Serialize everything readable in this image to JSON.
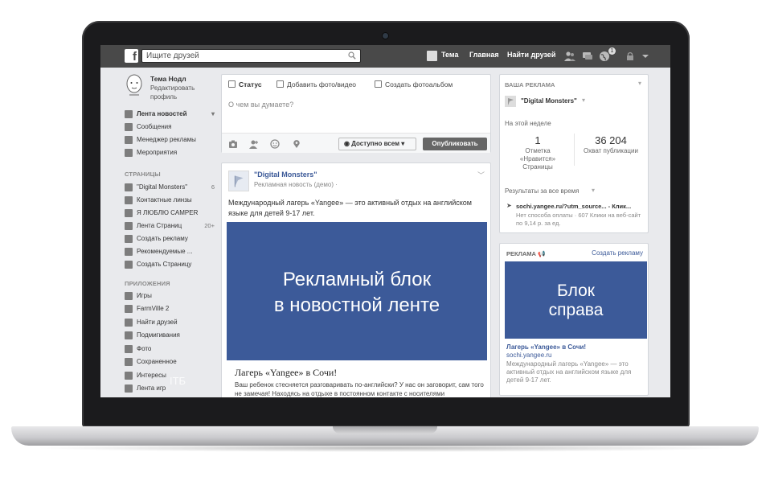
{
  "topbar": {
    "search_placeholder": "Ищите друзей",
    "nav_profile": "Тема",
    "nav_home": "Главная",
    "nav_find_friends": "Найти друзей",
    "notifications_count": "1"
  },
  "profile": {
    "name": "Тема Нодл",
    "edit_label": "Редактировать профиль"
  },
  "sidebar": {
    "favorites": [
      {
        "label": "Лента новостей",
        "icon": "news-feed-icon"
      },
      {
        "label": "Сообщения",
        "icon": "messages-icon"
      },
      {
        "label": "Менеджер рекламы",
        "icon": "ads-manager-icon"
      },
      {
        "label": "Мероприятия",
        "icon": "events-icon"
      }
    ],
    "pages_heading": "СТРАНИЦЫ",
    "pages": [
      {
        "label": "\"Digital Monsters\"",
        "count": "6"
      },
      {
        "label": "Контактные линзы",
        "count": ""
      },
      {
        "label": "Я ЛЮБЛЮ CAMPER",
        "count": ""
      },
      {
        "label": "Лента Страниц",
        "count": "20+"
      },
      {
        "label": "Создать рекламу",
        "count": ""
      },
      {
        "label": "Рекомендуемые ...",
        "count": ""
      },
      {
        "label": "Создать Страницу",
        "count": ""
      }
    ],
    "apps_heading": "ПРИЛОЖЕНИЯ",
    "apps": [
      {
        "label": "Игры"
      },
      {
        "label": "FarmVille 2"
      },
      {
        "label": "Найти друзей"
      },
      {
        "label": "Подмигивания"
      },
      {
        "label": "Фото"
      },
      {
        "label": "Сохраненное"
      },
      {
        "label": "Интересы"
      },
      {
        "label": "Лента игр"
      }
    ]
  },
  "composer": {
    "tab_status": "Статус",
    "tab_photo": "Добавить фото/видео",
    "tab_album": "Создать фотоальбом",
    "placeholder": "О чем вы думаете?",
    "audience": "Доступно всем",
    "publish": "Опубликовать"
  },
  "post": {
    "page_name": "\"Digital Monsters\"",
    "subtitle": "Рекламная новость (демо) ·",
    "text": "Международный лагерь «Yangee» — это активный отдых на английском языке для детей 9-17 лет.",
    "banner_line1": "Рекламный блок",
    "banner_line2": "в новостной ленте",
    "link_title": "Лагерь «Yangee» в Сочи!",
    "link_desc": "Ваш ребенок стесняется разговаривать по-английски? У нас он заговорит, сам того не замечая! Находясь на отдыхе в постоянном контакте с носителями"
  },
  "your_ads": {
    "heading": "ВАША РЕКЛАМА",
    "page_name": "\"Digital Monsters\"",
    "this_week": "На этой неделе",
    "likes_value": "1",
    "likes_label": "Отметка «Нравится» Страницы",
    "reach_value": "36 204",
    "reach_label": "Охват публикации",
    "all_time": "Результаты за все время",
    "result_url": "sochi.yangee.ru/?utm_source... - Клик...",
    "result_desc": "Нет способа оплаты · 607 Клики на веб-сайт по 9,14 р. за ед."
  },
  "ad_box": {
    "heading": "РЕКЛАМА",
    "create_ad": "Создать рекламу",
    "banner_line1": "Блок",
    "banner_line2": "справа",
    "link_title": "Лагерь «Yangee» в Сочи!",
    "domain": "sochi.yangee.ru",
    "desc": "Международный лагерь «Yangee» — это активный отдых на английском языке для детей 9-17 лет."
  },
  "watermark": "ITБ",
  "colors": {
    "topbar": "#494949",
    "fb_blue": "#3b5998",
    "banner_blue": "#3c5a99",
    "page_bg": "#e9eaed"
  }
}
